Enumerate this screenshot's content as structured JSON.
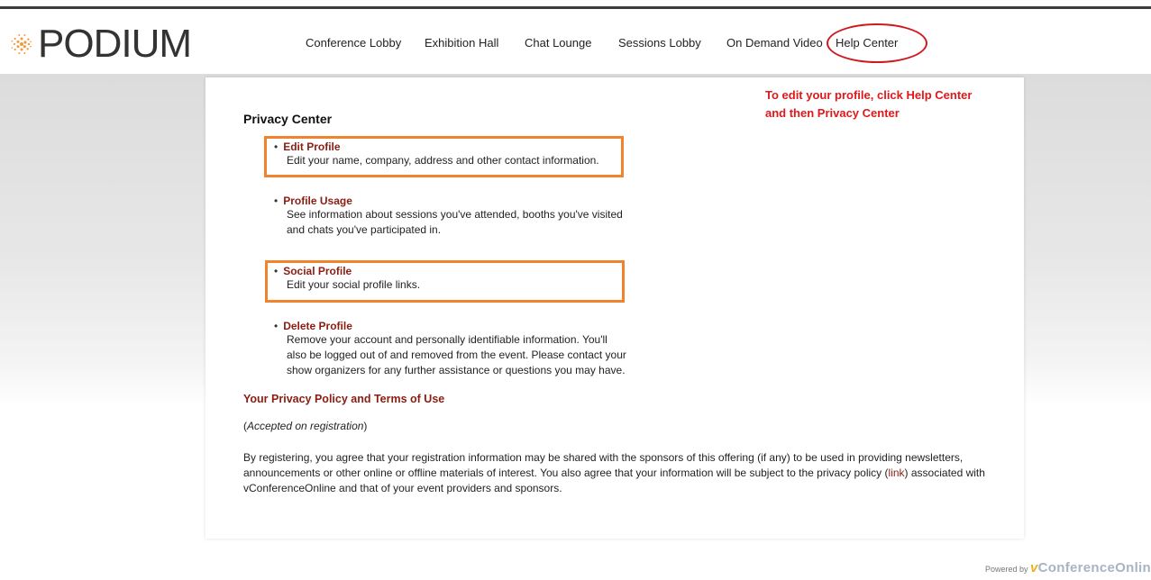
{
  "brand": {
    "logo_text": "PODIUM",
    "logo_icon": "starburst-icon"
  },
  "nav": {
    "items": [
      "Conference Lobby",
      "Exhibition Hall",
      "Chat Lounge",
      "Sessions Lobby",
      "On Demand Video",
      "Help Center"
    ]
  },
  "annotation": {
    "line1": "To edit your profile, click Help Center",
    "line2": "and then Privacy Center",
    "color": "#e0181a"
  },
  "privacy": {
    "title": "Privacy Center",
    "items": [
      {
        "title": "Edit Profile",
        "desc": [
          "Edit your name, company, address and other contact information."
        ]
      },
      {
        "title": "Profile Usage",
        "desc": [
          "See information about sessions you've attended, booths you've visited",
          "and chats you've participated in."
        ]
      },
      {
        "title": "Social Profile",
        "desc": [
          "Edit your social profile links."
        ]
      },
      {
        "title": "Delete Profile",
        "desc": [
          "Remove your account and personally identifiable information. You'll",
          "also be logged out of and removed from the event. Please contact your",
          "show organizers for any further assistance or questions you may have."
        ]
      }
    ]
  },
  "policy": {
    "title": "Your Privacy Policy and Terms of Use",
    "accepted_open": "(",
    "accepted": "Accepted on registration",
    "accepted_close": ")",
    "para_part1": "By registering, you agree that your registration information may be shared with the sponsors of this offering (if any) to be used in providing newsletters, announcements or other online or offline materials of interest. You also agree that your information will be subject to the privacy policy",
    "para_open": "(",
    "link": "link",
    "para_part2": ") associated with vConferenceOnline and that of your event providers and sponsors."
  },
  "footer": {
    "powered_by": "Powered by",
    "brand_v": "v",
    "brand_rest": "ConferenceOnlin"
  },
  "colors": {
    "link": "#8b1d12",
    "highlight_box": "#f2832d",
    "oval": "#d0191f"
  }
}
